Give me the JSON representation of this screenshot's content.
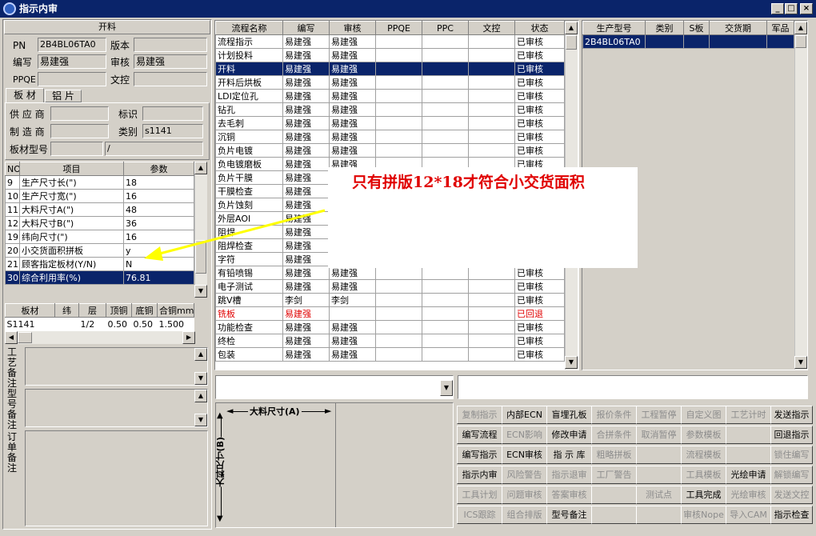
{
  "window": {
    "title": "指示内审",
    "min": "_",
    "max": "□",
    "close": "×"
  },
  "left": {
    "section_title": "开料",
    "pn_label": "PN",
    "pn_value": "2B4BL06TA0",
    "version_label": "版本",
    "version_value": "",
    "author_label": "编写",
    "author_value": "易建强",
    "review_label": "审核",
    "review_value": "易建强",
    "ppqe_label": "PPQE",
    "ppqe_value": "",
    "doc_label": "文控",
    "doc_value": "",
    "tabs": [
      "板 材",
      "铝 片"
    ],
    "supplier_label": "供 应 商",
    "supplier_value": "",
    "mark_label": "标识",
    "mark_value": "",
    "maker_label": "制 造 商",
    "maker_value": "",
    "category_label": "类别",
    "category_value": "s1141",
    "model_label": "板材型号",
    "model_value": "",
    "model_value2": "/",
    "param_headers": [
      "NO",
      "项目",
      "参数"
    ],
    "params": [
      [
        "9",
        "生产尺寸长(\")",
        "18"
      ],
      [
        "10",
        "生产尺寸宽(\")",
        "16"
      ],
      [
        "11",
        "大料尺寸A(\")",
        "48"
      ],
      [
        "12",
        "大料尺寸B(\")",
        "36"
      ],
      [
        "19",
        "纬向尺寸(\")",
        "16"
      ],
      [
        "20",
        "小交货面积拼板",
        "y"
      ],
      [
        "21",
        "顾客指定板材(Y/N)",
        "N"
      ],
      [
        "30",
        "综合利用率(%)",
        "76.81"
      ]
    ],
    "mat_headers": [
      "板材",
      "纬",
      "层",
      "顶铜",
      "底铜",
      "合铜mm"
    ],
    "mat_rows": [
      [
        "S1141",
        "",
        "1/2",
        "0.50",
        "0.50",
        "1.500"
      ]
    ],
    "note_labels": [
      "工艺备注",
      "型号备注",
      "订单备注"
    ]
  },
  "flow": {
    "headers": [
      "流程名称",
      "编写",
      "审核",
      "PPQE",
      "PPC",
      "文控",
      "状态"
    ],
    "rows": [
      [
        "流程指示",
        "易建强",
        "易建强",
        "",
        "",
        "",
        "已审核"
      ],
      [
        "计划投料",
        "易建强",
        "易建强",
        "",
        "",
        "",
        "已审核"
      ],
      [
        "开料",
        "易建强",
        "易建强",
        "",
        "",
        "",
        "已审核"
      ],
      [
        "开料后烘板",
        "易建强",
        "易建强",
        "",
        "",
        "",
        "已审核"
      ],
      [
        "LDI定位孔",
        "易建强",
        "易建强",
        "",
        "",
        "",
        "已审核"
      ],
      [
        "钻孔",
        "易建强",
        "易建强",
        "",
        "",
        "",
        "已审核"
      ],
      [
        "去毛刺",
        "易建强",
        "易建强",
        "",
        "",
        "",
        "已审核"
      ],
      [
        "沉铜",
        "易建强",
        "易建强",
        "",
        "",
        "",
        "已审核"
      ],
      [
        "负片电镀",
        "易建强",
        "易建强",
        "",
        "",
        "",
        "已审核"
      ],
      [
        "负电镀磨板",
        "易建强",
        "易建强",
        "",
        "",
        "",
        "已审核"
      ],
      [
        "负片干膜",
        "易建强",
        "",
        "",
        "",
        "",
        "已审核"
      ],
      [
        "干膜检查",
        "易建强",
        "",
        "",
        "",
        "",
        "已审核"
      ],
      [
        "负片蚀刻",
        "易建强",
        "",
        "",
        "",
        "",
        "已审核"
      ],
      [
        "外层AOI",
        "易建强",
        "",
        "",
        "",
        "",
        "已审核"
      ],
      [
        "阻焊",
        "易建强",
        "",
        "",
        "",
        "",
        "已审核"
      ],
      [
        "阻焊检查",
        "易建强",
        "",
        "",
        "",
        "",
        "已审核"
      ],
      [
        "字符",
        "易建强",
        "",
        "",
        "",
        "",
        "已审核"
      ],
      [
        "有铅喷锡",
        "易建强",
        "易建强",
        "",
        "",
        "",
        "已审核"
      ],
      [
        "电子测试",
        "易建强",
        "易建强",
        "",
        "",
        "",
        "已审核"
      ],
      [
        "跳V槽",
        "李剑",
        "李剑",
        "",
        "",
        "",
        "已审核"
      ],
      [
        "铣板",
        "易建强",
        "",
        "",
        "",
        "",
        "已回退"
      ],
      [
        "功能检查",
        "易建强",
        "易建强",
        "",
        "",
        "",
        "已审核"
      ],
      [
        "终检",
        "易建强",
        "易建强",
        "",
        "",
        "",
        "已审核"
      ],
      [
        "包装",
        "易建强",
        "易建强",
        "",
        "",
        "",
        "已审核"
      ]
    ]
  },
  "right": {
    "headers": [
      "生产型号",
      "类别",
      "S板",
      "交货期",
      "军品"
    ],
    "rows": [
      [
        "2B4BL06TA0",
        "",
        "",
        "",
        ""
      ]
    ]
  },
  "annotation": {
    "text": "只有拼版12*18才符合小交货面积",
    "color": "#e00000"
  },
  "diagram": {
    "label_a": "大料尺寸(A)",
    "label_b": "大料尺寸(B)"
  },
  "buttons": [
    [
      "复制指示",
      "内部ECN",
      "盲埋孔板",
      "报价条件",
      "工程暂停",
      "自定义图",
      "工艺计时",
      "发送指示"
    ],
    [
      "编写流程",
      "ECN影响",
      "修改申请",
      "合拼条件",
      "取消暂停",
      "参数模板",
      "",
      "回退指示"
    ],
    [
      "编写指示",
      "ECN审核",
      "指 示 库",
      "粗略拼板",
      "",
      "流程模板",
      "",
      "锁住编写"
    ],
    [
      "指示内审",
      "风险警告",
      "指示退审",
      "工厂警告",
      "",
      "工具模板",
      "光绘申请",
      "解锁编写"
    ],
    [
      "工具计划",
      "问题审核",
      "答案审核",
      "",
      "测试点",
      "工具完成",
      "光绘审核",
      "发送文控"
    ],
    [
      "ICS跟踪",
      "组合排版",
      "型号备注",
      "",
      "",
      "审核Nope",
      "导入CAM",
      "指示检查"
    ]
  ],
  "button_enabled": [
    [
      false,
      true,
      true,
      false,
      false,
      false,
      false,
      true
    ],
    [
      true,
      false,
      true,
      false,
      false,
      false,
      false,
      true
    ],
    [
      true,
      true,
      true,
      false,
      false,
      false,
      false,
      false
    ],
    [
      true,
      false,
      false,
      false,
      false,
      false,
      true,
      false
    ],
    [
      false,
      false,
      false,
      false,
      false,
      true,
      false,
      false
    ],
    [
      false,
      false,
      true,
      false,
      false,
      false,
      false,
      true
    ]
  ]
}
